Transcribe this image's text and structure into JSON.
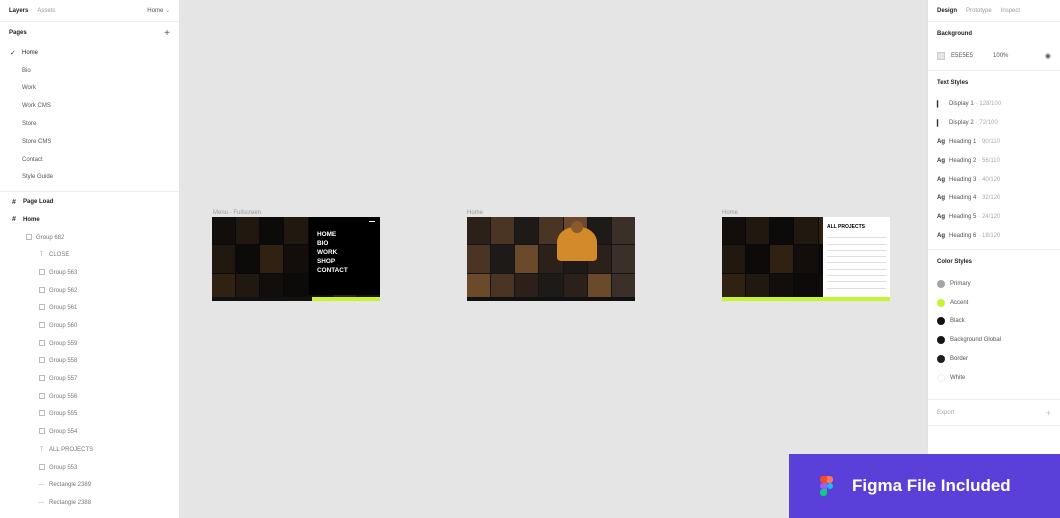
{
  "left_panel": {
    "tabs": {
      "layers": "Layers",
      "assets": "Assets"
    },
    "current_page": "Home",
    "pages_title": "Pages",
    "pages": [
      "Home",
      "Bio",
      "Work",
      "Work CMS",
      "Store",
      "Store CMS",
      "Contact",
      "Style Guide"
    ],
    "layers": [
      {
        "label": "Page Load",
        "level": 0,
        "kind": "frame"
      },
      {
        "label": "Home",
        "level": 0,
        "kind": "frame"
      },
      {
        "label": "Group 682",
        "level": 1,
        "kind": "group"
      },
      {
        "label": "CLOSE",
        "level": 2,
        "kind": "text"
      },
      {
        "label": "Group 563",
        "level": 2,
        "kind": "group"
      },
      {
        "label": "Group 562",
        "level": 2,
        "kind": "group"
      },
      {
        "label": "Group 561",
        "level": 2,
        "kind": "group"
      },
      {
        "label": "Group 560",
        "level": 2,
        "kind": "group"
      },
      {
        "label": "Group 559",
        "level": 2,
        "kind": "group"
      },
      {
        "label": "Group 558",
        "level": 2,
        "kind": "group"
      },
      {
        "label": "Group 557",
        "level": 2,
        "kind": "group"
      },
      {
        "label": "Group 556",
        "level": 2,
        "kind": "group"
      },
      {
        "label": "Group 555",
        "level": 2,
        "kind": "group"
      },
      {
        "label": "Group 554",
        "level": 2,
        "kind": "group"
      },
      {
        "label": "ALL PROJECTS",
        "level": 2,
        "kind": "text"
      },
      {
        "label": "Group 553",
        "level": 2,
        "kind": "group"
      },
      {
        "label": "Rectangle 2389",
        "level": 2,
        "kind": "rect"
      },
      {
        "label": "Rectangle 2388",
        "level": 2,
        "kind": "rect"
      }
    ]
  },
  "canvas": {
    "frames": [
      {
        "label": "Menu - Fullscreen",
        "menu_links": [
          "HOME",
          "BIO",
          "WORK",
          "SHOP",
          "CONTACT"
        ]
      },
      {
        "label": "Home"
      },
      {
        "label": "Home",
        "list_title": "ALL PROJECTS"
      }
    ]
  },
  "right_panel": {
    "tabs": {
      "design": "Design",
      "prototype": "Prototype",
      "inspect": "Inspect"
    },
    "background_title": "Background",
    "background": {
      "hex": "E5E5E5",
      "opacity": "100%"
    },
    "text_styles_title": "Text Styles",
    "text_styles": [
      {
        "icon": "display",
        "name": "Display 1",
        "meta": " · 128/100"
      },
      {
        "icon": "display",
        "name": "Display 2",
        "meta": " · 72/100"
      },
      {
        "icon": "heading",
        "name": "Heading 1",
        "meta": " · 90/110"
      },
      {
        "icon": "heading",
        "name": "Heading 2",
        "meta": " · 56/110"
      },
      {
        "icon": "heading",
        "name": "Heading 3",
        "meta": " · 40/120"
      },
      {
        "icon": "heading",
        "name": "Heading 4",
        "meta": " · 32/120"
      },
      {
        "icon": "heading",
        "name": "Heading 5",
        "meta": " · 24/120"
      },
      {
        "icon": "heading",
        "name": "Heading 6",
        "meta": " · 18/120"
      }
    ],
    "color_styles_title": "Color Styles",
    "color_styles": [
      {
        "name": "Primary",
        "color": "#A6A6A6"
      },
      {
        "name": "Accent",
        "color": "#C6F432"
      },
      {
        "name": "Black",
        "color": "#111111"
      },
      {
        "name": "Background Global",
        "color": "#161616"
      },
      {
        "name": "Border",
        "color": "#1E1E1E"
      },
      {
        "name": "White",
        "color": "#FFFFFF"
      }
    ],
    "export_label": "Export"
  },
  "banner": {
    "text": "Figma File Included",
    "color": "#5B3FD9"
  }
}
